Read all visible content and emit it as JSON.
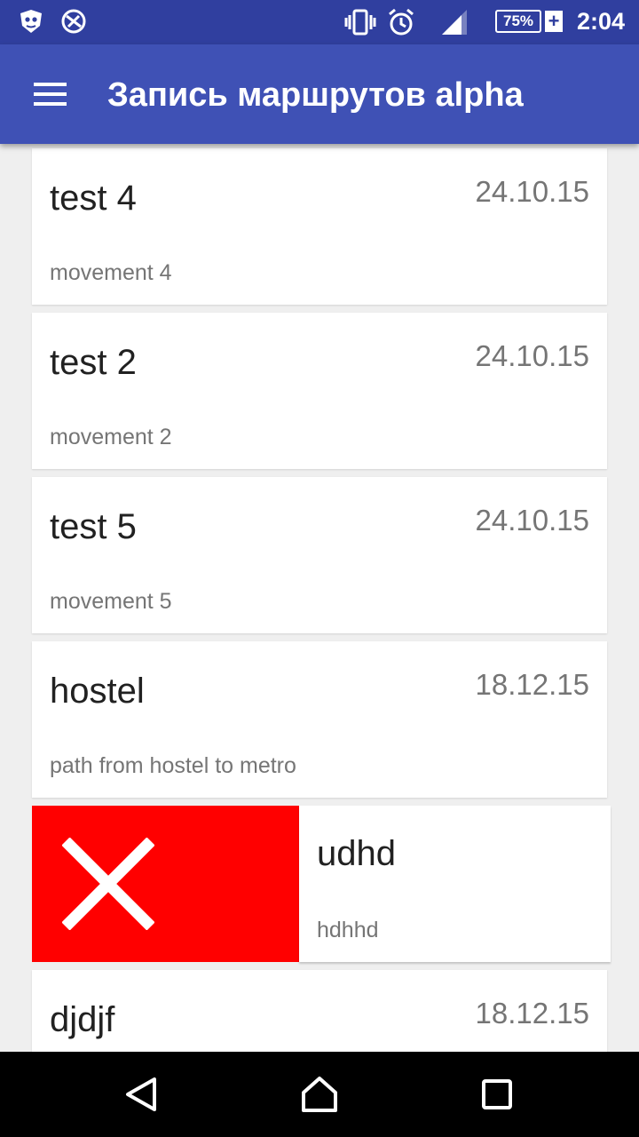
{
  "status_bar": {
    "time": "2:04",
    "battery": "75%",
    "battery_charging": "+",
    "icons": [
      "shield-app-icon",
      "no-location-icon",
      "vibrate-icon",
      "alarm-icon",
      "signal-icon",
      "battery-icon"
    ]
  },
  "app_bar": {
    "title": "Запись маршрутов alpha",
    "menu_icon": "hamburger-menu-icon"
  },
  "routes": [
    {
      "title": "test 4",
      "date": "24.10.15",
      "description": "movement 4"
    },
    {
      "title": "test 2",
      "date": "24.10.15",
      "description": "movement 2"
    },
    {
      "title": "test 5",
      "date": "24.10.15",
      "description": "movement 5"
    },
    {
      "title": "hostel",
      "date": "18.12.15",
      "description": "path from hostel to metro"
    },
    {
      "title": "udhd",
      "date": "",
      "description": "hdhhd",
      "swiped": true
    },
    {
      "title": "djdjf",
      "date": "18.12.15",
      "description": ""
    }
  ],
  "swipe_action": {
    "icon": "delete-x-icon",
    "color": "#ff0000"
  },
  "nav_bar": {
    "icons": [
      "back-icon",
      "home-icon",
      "recents-icon"
    ]
  },
  "colors": {
    "status_bar": "#303f9f",
    "app_bar": "#3f51b5",
    "background": "#efefef"
  }
}
